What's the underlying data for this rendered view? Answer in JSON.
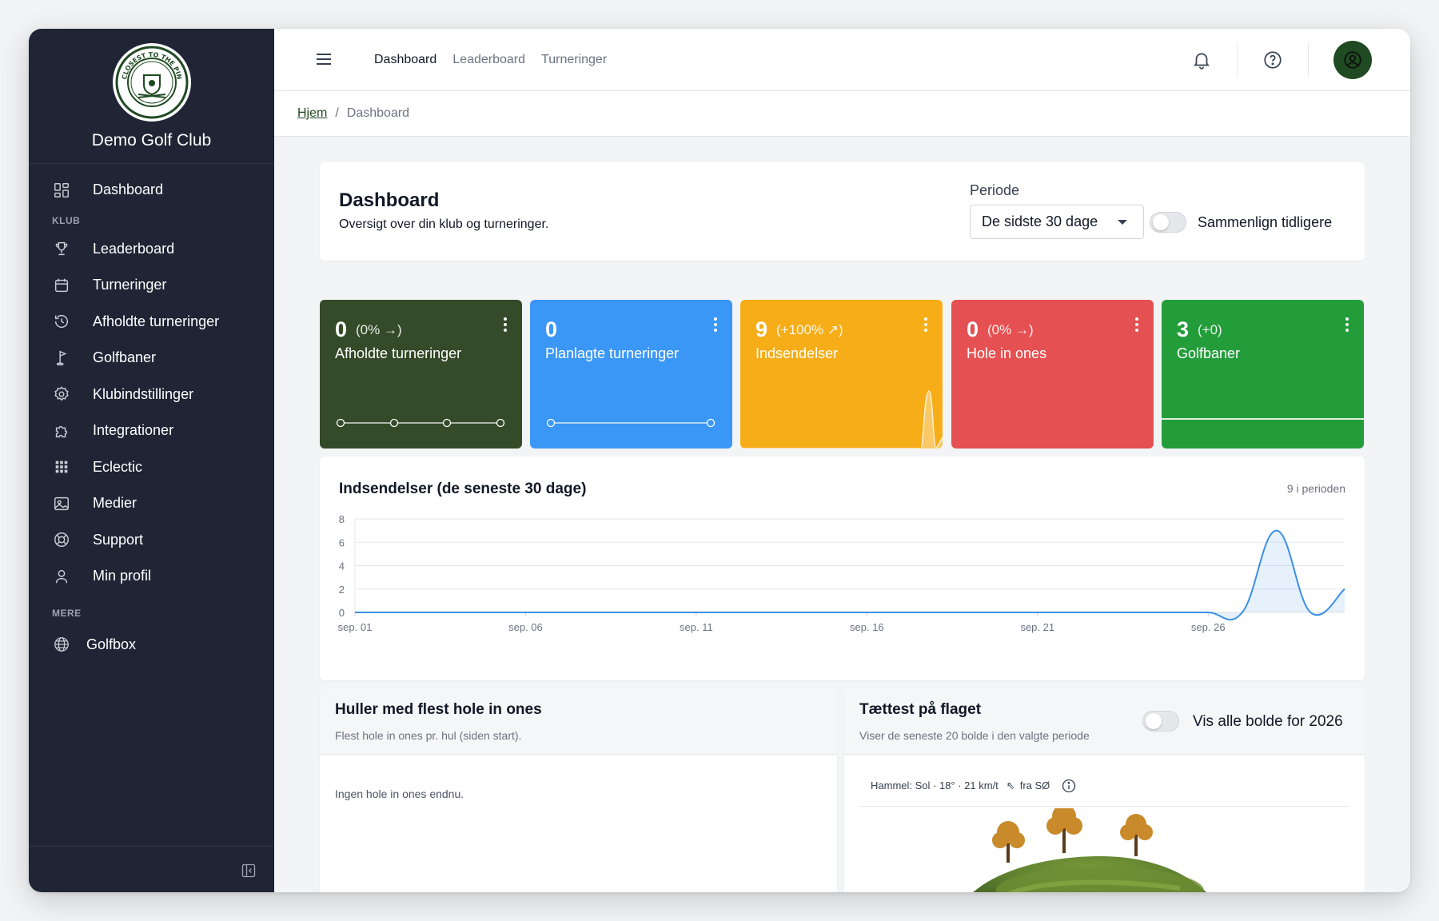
{
  "sidebar": {
    "club_name": "Demo Golf Club",
    "logo_text": "CLOSEST TO THE PIN",
    "items_main": [
      {
        "label": "Dashboard",
        "icon": "grid-icon"
      }
    ],
    "section_klub": "KLUB",
    "items_klub": [
      {
        "label": "Leaderboard",
        "icon": "trophy-icon"
      },
      {
        "label": "Turneringer",
        "icon": "calendar-icon"
      },
      {
        "label": "Afholdte turneringer",
        "icon": "history-icon"
      },
      {
        "label": "Golfbaner",
        "icon": "golf-flag-icon"
      },
      {
        "label": "Klubindstillinger",
        "icon": "gear-icon"
      },
      {
        "label": "Integrationer",
        "icon": "puzzle-icon"
      },
      {
        "label": "Eclectic",
        "icon": "dots-grid-icon"
      },
      {
        "label": "Medier",
        "icon": "image-icon"
      },
      {
        "label": "Support",
        "icon": "lifebuoy-icon"
      },
      {
        "label": "Min profil",
        "icon": "user-icon"
      }
    ],
    "section_mere": "MERE",
    "items_mere": [
      {
        "label": "Golfbox",
        "icon": "globe-icon"
      }
    ]
  },
  "topbar": {
    "links": [
      {
        "label": "Dashboard",
        "active": true
      },
      {
        "label": "Leaderboard",
        "active": false
      },
      {
        "label": "Turneringer",
        "active": false
      }
    ]
  },
  "breadcrumb": {
    "home": "Hjem",
    "separator": "/",
    "current": "Dashboard"
  },
  "header": {
    "title": "Dashboard",
    "subtitle": "Oversigt over din klub og turneringer.",
    "periode_label": "Periode",
    "periode_value": "De sidste 30 dage",
    "compare_label": "Sammenlign tidligere",
    "compare_on": false
  },
  "tiles": [
    {
      "value": "0",
      "change": "(0% →)",
      "label": "Afholdte turneringer",
      "color": "#344a28",
      "spark": "dots4"
    },
    {
      "value": "0",
      "change": "",
      "label": "Planlagte turneringer",
      "color": "#3b97f5",
      "spark": "dots2"
    },
    {
      "value": "9",
      "change": "(+100% ↗)",
      "label": "Indsendelser",
      "color": "#f6ad17",
      "spark": "peak"
    },
    {
      "value": "0",
      "change": "(0% →)",
      "label": "Hole in ones",
      "color": "#e55152",
      "spark": "none"
    },
    {
      "value": "3",
      "change": "(+0)",
      "label": "Golfbaner",
      "color": "#239d3a",
      "spark": "flat"
    }
  ],
  "chart": {
    "title": "Indsendelser (de seneste 30 dage)",
    "meta": "9 i perioden"
  },
  "chart_data": {
    "type": "area",
    "title": "Indsendelser (de seneste 30 dage)",
    "xlabel": "",
    "ylabel": "",
    "ylim": [
      0,
      8
    ],
    "yticks": [
      0,
      2,
      4,
      6,
      8
    ],
    "x_tick_labels": [
      "sep. 01",
      "sep. 06",
      "sep. 11",
      "sep. 16",
      "sep. 21",
      "sep. 26"
    ],
    "x": [
      "sep. 01",
      "sep. 02",
      "sep. 03",
      "sep. 04",
      "sep. 05",
      "sep. 06",
      "sep. 07",
      "sep. 08",
      "sep. 09",
      "sep. 10",
      "sep. 11",
      "sep. 12",
      "sep. 13",
      "sep. 14",
      "sep. 15",
      "sep. 16",
      "sep. 17",
      "sep. 18",
      "sep. 19",
      "sep. 20",
      "sep. 21",
      "sep. 22",
      "sep. 23",
      "sep. 24",
      "sep. 25",
      "sep. 26",
      "sep. 27",
      "sep. 28",
      "sep. 29",
      "sep. 30"
    ],
    "series": [
      {
        "values": [
          0,
          0,
          0,
          0,
          0,
          0,
          0,
          0,
          0,
          0,
          0,
          0,
          0,
          0,
          0,
          0,
          0,
          0,
          0,
          0,
          0,
          0,
          0,
          0,
          0,
          0,
          0,
          7,
          0,
          2
        ]
      }
    ],
    "color": "#3b8fe6",
    "grid": true
  },
  "holes": {
    "title": "Huller med flest hole in ones",
    "subtitle": "Flest hole in ones pr. hul (siden start).",
    "empty": "Ingen hole in ones endnu."
  },
  "flag": {
    "title": "Tættest på flaget",
    "subtitle": "Viser de seneste 20 bolde i den valgte periode",
    "toggle_label": "Vis alle bolde for 2026",
    "toggle_on": false,
    "weather_text": "Hammel: Sol · 18° · 21 km/t",
    "wind_arrow": "⇖",
    "wind_dir": "fra SØ"
  }
}
